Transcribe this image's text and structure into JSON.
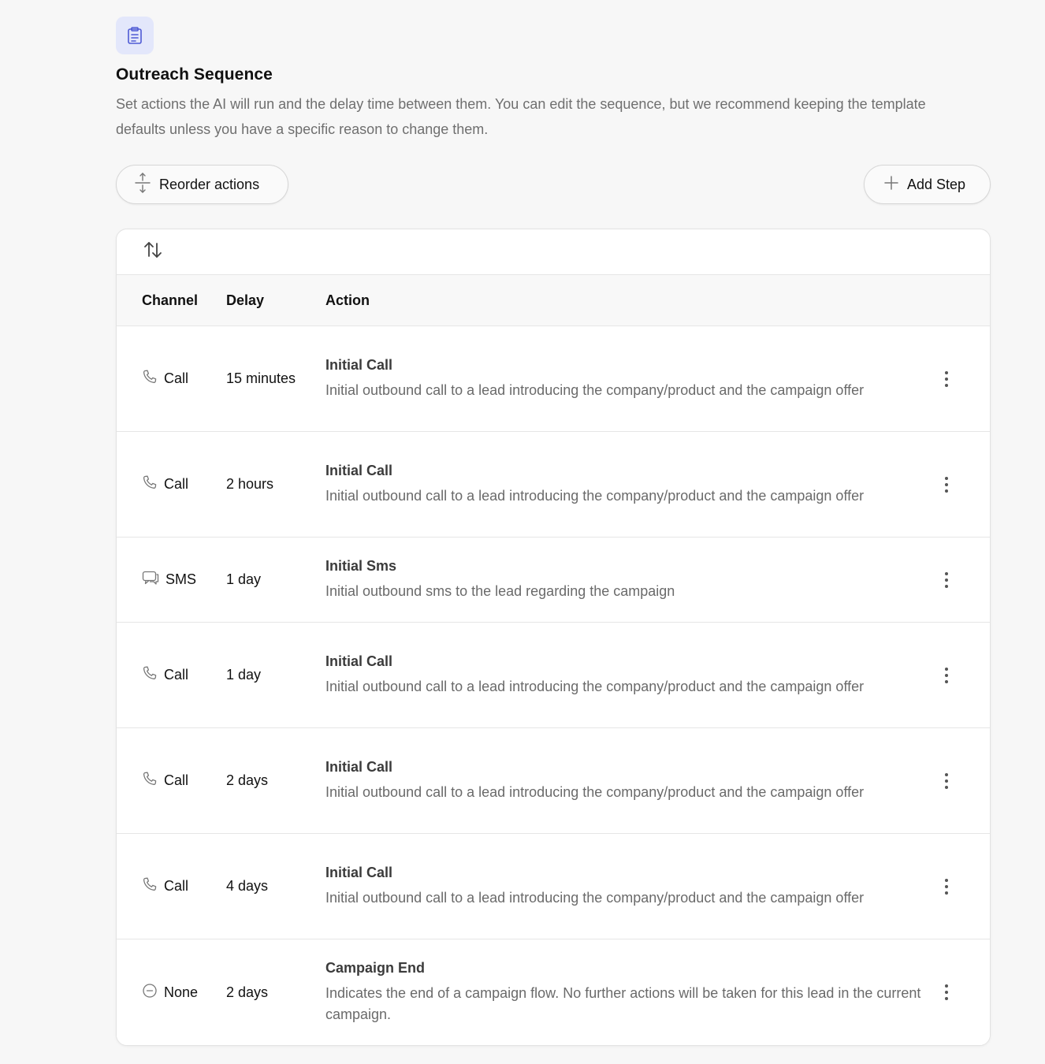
{
  "header": {
    "title": "Outreach Sequence",
    "description": "Set actions the AI will run and the delay time between them. You can edit the sequence, but we recommend keeping the template defaults unless you have a specific reason to change them."
  },
  "toolbar": {
    "reorder_label": "Reorder actions",
    "add_label": "Add Step"
  },
  "table": {
    "columns": {
      "channel": "Channel",
      "delay": "Delay",
      "action": "Action"
    },
    "rows": [
      {
        "channel": "Call",
        "icon": "phone-icon",
        "delay": "15 minutes",
        "title": "Initial Call",
        "desc": "Initial outbound call to a lead introducing the company/product and the campaign offer"
      },
      {
        "channel": "Call",
        "icon": "phone-icon",
        "delay": "2 hours",
        "title": "Initial Call",
        "desc": "Initial outbound call to a lead introducing the company/product and the campaign offer"
      },
      {
        "channel": "SMS",
        "icon": "chat-icon",
        "delay": "1 day",
        "title": "Initial Sms",
        "desc": "Initial outbound sms to the lead regarding the campaign"
      },
      {
        "channel": "Call",
        "icon": "phone-icon",
        "delay": "1 day",
        "title": "Initial Call",
        "desc": "Initial outbound call to a lead introducing the company/product and the campaign offer"
      },
      {
        "channel": "Call",
        "icon": "phone-icon",
        "delay": "2 days",
        "title": "Initial Call",
        "desc": "Initial outbound call to a lead introducing the company/product and the campaign offer"
      },
      {
        "channel": "Call",
        "icon": "phone-icon",
        "delay": "4 days",
        "title": "Initial Call",
        "desc": "Initial outbound call to a lead introducing the company/product and the campaign offer"
      },
      {
        "channel": "None",
        "icon": "minus-circle-icon",
        "delay": "2 days",
        "title": "Campaign End",
        "desc": "Indicates the end of a campaign flow. No further actions will be taken for this lead in the current campaign."
      }
    ]
  },
  "colors": {
    "accent_bg": "#e3e7fb",
    "accent": "#4f5bd5",
    "text_muted": "#6f6f6f"
  }
}
